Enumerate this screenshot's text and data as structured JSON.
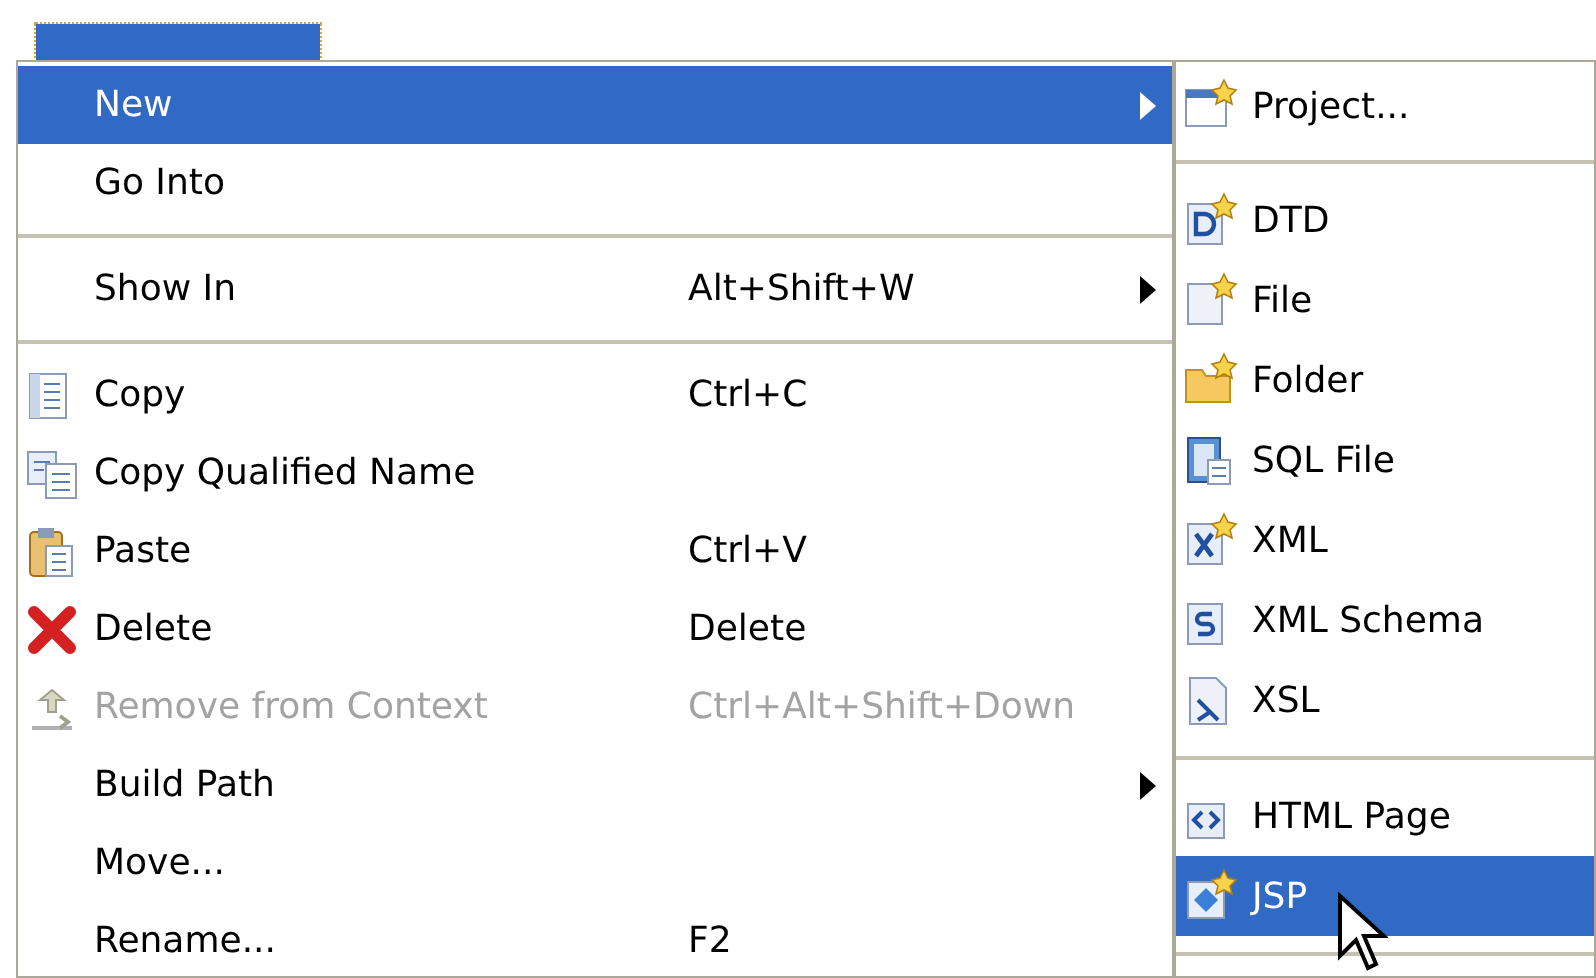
{
  "context_menu": {
    "items": [
      {
        "kind": "item",
        "label": "New",
        "submenu": true,
        "selected": true,
        "disabled": false
      },
      {
        "kind": "item",
        "label": "Go Into",
        "selected": false,
        "disabled": false
      },
      {
        "kind": "separator"
      },
      {
        "kind": "item",
        "label": "Show In",
        "shortcut": "Alt+Shift+W",
        "submenu": true,
        "selected": false,
        "disabled": false
      },
      {
        "kind": "separator"
      },
      {
        "kind": "item",
        "label": "Copy",
        "shortcut": "Ctrl+C",
        "selected": false,
        "disabled": false
      },
      {
        "kind": "item",
        "label": "Copy Qualified Name",
        "selected": false,
        "disabled": false
      },
      {
        "kind": "item",
        "label": "Paste",
        "shortcut": "Ctrl+V",
        "selected": false,
        "disabled": false
      },
      {
        "kind": "item",
        "label": "Delete",
        "shortcut": "Delete",
        "selected": false,
        "disabled": false
      },
      {
        "kind": "item",
        "label": "Remove from Context",
        "shortcut": "Ctrl+Alt+Shift+Down",
        "selected": false,
        "disabled": true
      },
      {
        "kind": "item",
        "label": "Build Path",
        "submenu": true,
        "selected": false,
        "disabled": false
      },
      {
        "kind": "item",
        "label": "Move...",
        "selected": false,
        "disabled": false
      },
      {
        "kind": "item",
        "label": "Rename...",
        "shortcut": "F2",
        "selected": false,
        "disabled": false
      }
    ]
  },
  "submenu": {
    "items": [
      {
        "kind": "item",
        "label": "Project...",
        "selected": false
      },
      {
        "kind": "separator"
      },
      {
        "kind": "item",
        "label": "DTD",
        "selected": false
      },
      {
        "kind": "item",
        "label": "File",
        "selected": false
      },
      {
        "kind": "item",
        "label": "Folder",
        "selected": false
      },
      {
        "kind": "item",
        "label": "SQL File",
        "selected": false
      },
      {
        "kind": "item",
        "label": "XML",
        "selected": false
      },
      {
        "kind": "item",
        "label": "XML Schema",
        "selected": false
      },
      {
        "kind": "item",
        "label": "XSL",
        "selected": false
      },
      {
        "kind": "separator"
      },
      {
        "kind": "item",
        "label": "HTML Page",
        "selected": false
      },
      {
        "kind": "item",
        "label": "JSP",
        "selected": true
      },
      {
        "kind": "separator"
      }
    ]
  }
}
